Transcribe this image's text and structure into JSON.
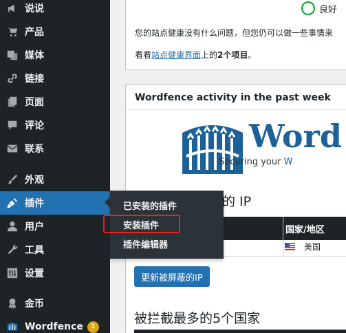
{
  "sidebar": {
    "items": [
      {
        "key": "comments-top",
        "label": "说说",
        "icon": "megaphone-icon"
      },
      {
        "key": "products",
        "label": "产品",
        "icon": "cart-icon"
      },
      {
        "key": "media",
        "label": "媒体",
        "icon": "media-icon"
      },
      {
        "key": "links",
        "label": "链接",
        "icon": "link-icon"
      },
      {
        "key": "pages",
        "label": "页面",
        "icon": "page-icon"
      },
      {
        "key": "comments",
        "label": "评论",
        "icon": "comment-icon"
      },
      {
        "key": "contact",
        "label": "联系",
        "icon": "mail-icon"
      },
      {
        "key": "appearance",
        "label": "外观",
        "icon": "brush-icon"
      },
      {
        "key": "plugins",
        "label": "插件",
        "icon": "plugin-icon"
      },
      {
        "key": "users",
        "label": "用户",
        "icon": "user-icon"
      },
      {
        "key": "tools",
        "label": "工具",
        "icon": "wrench-icon"
      },
      {
        "key": "settings",
        "label": "设置",
        "icon": "settings-icon"
      },
      {
        "key": "coins",
        "label": "金币",
        "icon": "award-icon"
      },
      {
        "key": "wordfence",
        "label": "Wordfence",
        "icon": "wordfence-icon",
        "badge": "1"
      }
    ]
  },
  "flyout": {
    "items": [
      "已安装的插件",
      "安装插件",
      "插件编辑器"
    ]
  },
  "health": {
    "status": "良好",
    "message": "您的站点健康没有什么问题，但您仍可以做一些事情来",
    "link_prefix": "看看",
    "link_text": "站点健康界面",
    "link_mid": "上的",
    "count_text": "2个项目",
    "link_suffix": "。"
  },
  "wordfence": {
    "title": "Wordfence activity in the past week",
    "logo_word": "Word",
    "tagline": "Securing your ",
    "tagline_accent": "W",
    "ip_heading": "的 IP",
    "country_header": "国家/地区",
    "country_value": "美国",
    "refresh_button": "更新被屏蔽的IP",
    "top5_heading": "被拦截最多的5个国家"
  },
  "colors": {
    "sidebar_bg": "#1d2327",
    "active_blue": "#2271b1",
    "highlight_red": "#e0261f",
    "wordfence_blue": "#1c6197"
  }
}
